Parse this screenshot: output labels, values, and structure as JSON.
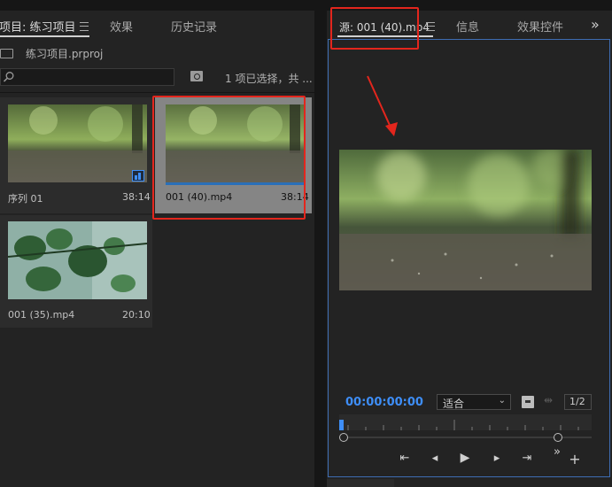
{
  "top_tabs_left": {
    "project": "项目: 练习项目",
    "effects": "效果",
    "history": "历史记录"
  },
  "top_tabs_right": {
    "source": "源: 001 (40).mp4",
    "info": "信息",
    "effect_controls": "效果控件",
    "overflow": "»"
  },
  "project_panel": {
    "file_name": "练习项目.prproj",
    "search_placeholder": "",
    "selection_status": "1 项已选择，共 ..."
  },
  "clips": [
    {
      "name": "序列 01",
      "duration": "38:14"
    },
    {
      "name": "001 (40).mp4",
      "duration": "38:14"
    },
    {
      "name": "001 (35).mp4",
      "duration": "20:10"
    }
  ],
  "source_monitor": {
    "timecode": "00:00:00:00",
    "zoom": "适合",
    "resolution": "1/2",
    "playhead_fraction": 0.0,
    "in_fraction": 0.0,
    "out_fraction": 0.88
  },
  "colors": {
    "accent_blue": "#3e8ef7",
    "annotation_red": "#e3261d",
    "panel_bg": "#232323"
  },
  "icons": {
    "folder": "folder-icon",
    "search": "search-icon",
    "new_bin": "new-bin-icon",
    "sequence": "sequence-icon",
    "export_frame": "camera-icon",
    "go_in": "go-to-in-icon",
    "step_back": "step-back-icon",
    "play": "play-icon",
    "step_forward": "step-forward-icon",
    "go_out": "go-to-out-icon",
    "add": "plus-icon"
  }
}
